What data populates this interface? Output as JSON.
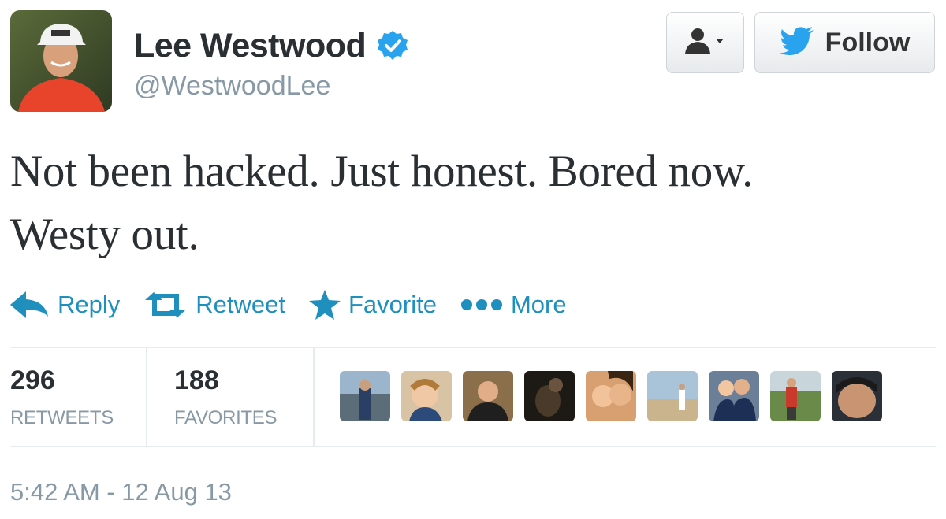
{
  "user": {
    "full_name": "Lee Westwood",
    "screen_name": "@WestwoodLee",
    "verified": true,
    "avatar_icon": "golfer-portrait-avatar"
  },
  "buttons": {
    "user_dropdown_icon": "person-dropdown-icon",
    "follow_label": "Follow",
    "follow_icon": "twitter-bird-icon"
  },
  "tweet": {
    "text_line1": "Not been hacked. Just honest. Bored now.",
    "text_line2": "Westy out.",
    "timestamp": "5:42 AM - 12 Aug 13"
  },
  "actions": [
    {
      "label": "Reply",
      "icon": "reply-icon"
    },
    {
      "label": "Retweet",
      "icon": "retweet-icon"
    },
    {
      "label": "Favorite",
      "icon": "star-icon"
    },
    {
      "label": "More",
      "icon": "more-dots-icon"
    }
  ],
  "stats": {
    "retweets_count": "296",
    "retweets_label": "RETWEETS",
    "favorites_count": "188",
    "favorites_label": "FAVORITES"
  },
  "colors": {
    "link": "#1f8fbe",
    "verified": "#2aa3ef",
    "muted": "#8899a6",
    "text": "#292f33"
  },
  "favoriter_avatars": [
    "avatar-1",
    "avatar-2",
    "avatar-3",
    "avatar-4",
    "avatar-5",
    "avatar-6",
    "avatar-7",
    "avatar-8",
    "avatar-9"
  ]
}
